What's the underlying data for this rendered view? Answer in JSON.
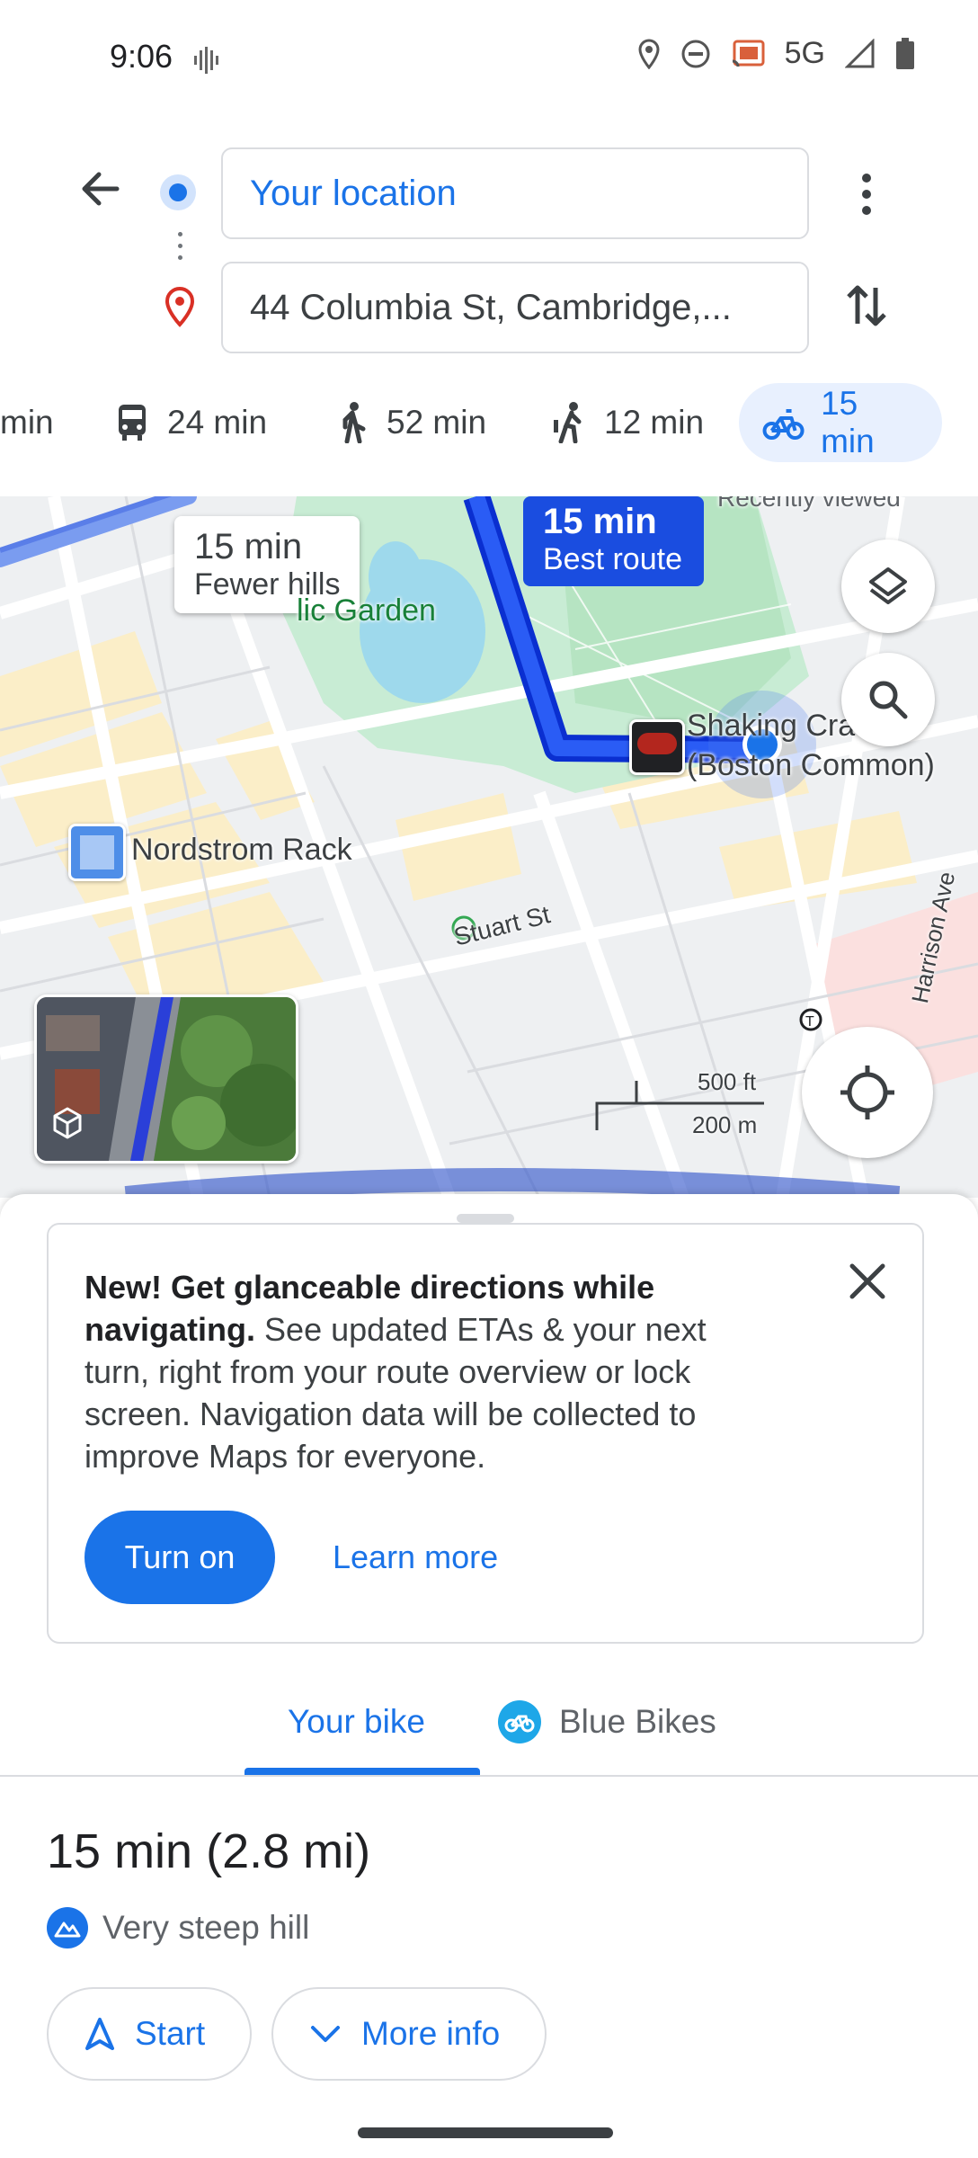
{
  "status_bar": {
    "time": "9:06",
    "network": "5G"
  },
  "search": {
    "origin": "Your location",
    "destination": "44 Columbia St, Cambridge,..."
  },
  "modes": [
    {
      "icon": "car-icon",
      "label": "min"
    },
    {
      "icon": "transit-icon",
      "label": "24 min"
    },
    {
      "icon": "walk-icon",
      "label": "52 min"
    },
    {
      "icon": "rideshare-icon",
      "label": "12 min"
    },
    {
      "icon": "bike-icon",
      "label": "15 min",
      "active": true
    }
  ],
  "map": {
    "alt_route": {
      "time": "15 min",
      "note": "Fewer hills"
    },
    "best_route": {
      "time": "15 min",
      "note": "Best route"
    },
    "labels": {
      "recently_viewed": "Recently viewed",
      "garden": "lic Garden",
      "place_name": "Shaking Cra",
      "place_sub": "(Boston Common)",
      "nordstrom": "Nordstrom Rack",
      "stuart": "Stuart St",
      "harrison": "Harrison Ave"
    },
    "scale": {
      "feet": "500 ft",
      "meters": "200 m"
    }
  },
  "promo": {
    "bold": "New! Get glanceable directions while navigating.",
    "body": " See updated ETAs & your next turn, right from your route overview or lock screen. Navigation data will be collected to improve Maps for everyone.",
    "turn_on": "Turn on",
    "learn_more": "Learn more"
  },
  "tabs": {
    "your_bike": "Your bike",
    "blue_bikes": "Blue Bikes"
  },
  "route": {
    "summary": "15 min (2.8 mi)",
    "warning": "Very steep hill",
    "start": "Start",
    "more_info": "More info"
  },
  "colors": {
    "accent": "#1a73e8",
    "route": "#1a4de0",
    "park": "#c8ecd4",
    "water": "#9ed9ec"
  }
}
